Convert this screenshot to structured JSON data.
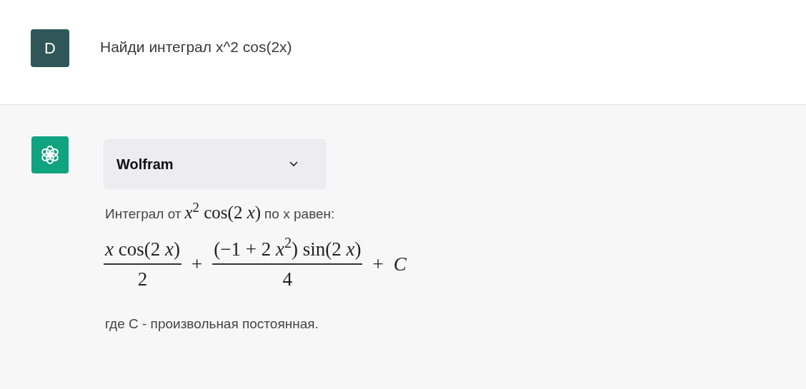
{
  "user_message": {
    "avatar": "D",
    "text": "Найди интеграл x^2 cos(2x)"
  },
  "assistant_message": {
    "plugin": {
      "label": "Wolfram",
      "expanded": false
    },
    "intro": [
      {
        "kind": "text",
        "text": "Интеграл от"
      },
      {
        "kind": "math",
        "text": "*x*$^{2}$ cos(2 *x*)"
      },
      {
        "kind": "text",
        "text": "по x равен:"
      }
    ],
    "formula": [
      {
        "kind": "fraction",
        "numerator": "*x* cos(2 *x*)",
        "denominator": "2"
      },
      {
        "kind": "operator",
        "text": "+"
      },
      {
        "kind": "fraction",
        "numerator": "(−1 + 2 *x*$^{2}$) sin(2 *x*)",
        "denominator": "4"
      },
      {
        "kind": "operator",
        "text": "+"
      },
      {
        "kind": "symbol",
        "text": "*C*"
      }
    ],
    "note": "где C - произвольная постоянная."
  }
}
